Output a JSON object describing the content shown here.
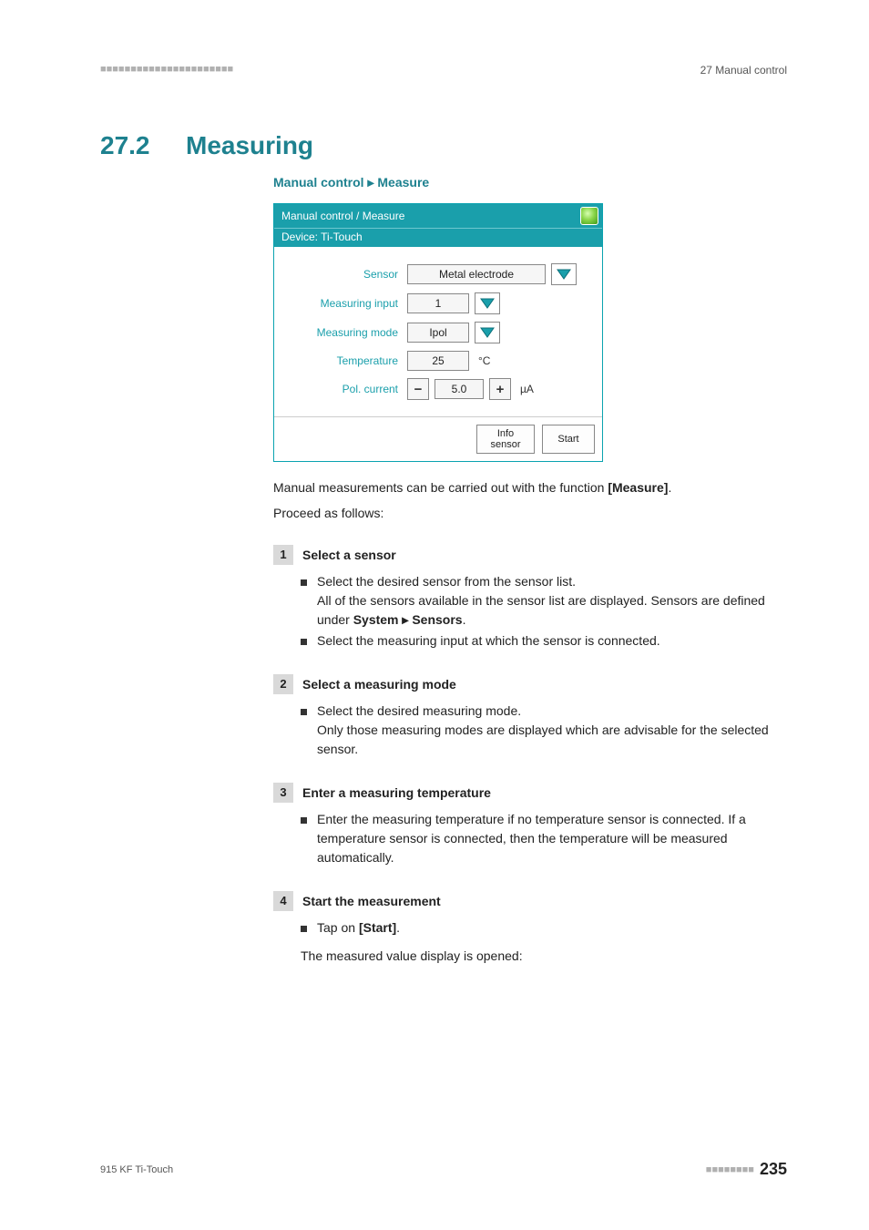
{
  "page": {
    "chapter_ref": "27 Manual control",
    "section_number": "27.2",
    "section_title": "Measuring",
    "breadcrumb_prefix": "Manual control",
    "breadcrumb_sep": "▸",
    "breadcrumb_leaf": "Measure",
    "paragraph_1a": "Manual measurements can be carried out with the function ",
    "paragraph_1_bold": "[Measure]",
    "paragraph_1b": ".",
    "paragraph_2": "Proceed as follows:",
    "footer_device": "915 KF Ti-Touch",
    "page_number": "235"
  },
  "panel": {
    "title": "Manual control / Measure",
    "device_line": "Device: Ti-Touch",
    "rows": {
      "sensor": {
        "label": "Sensor",
        "value": "Metal electrode"
      },
      "measuring_input": {
        "label": "Measuring input",
        "value": "1"
      },
      "measuring_mode": {
        "label": "Measuring mode",
        "value": "Ipol"
      },
      "temperature": {
        "label": "Temperature",
        "value": "25",
        "unit": "°C"
      },
      "pol_current": {
        "label": "Pol. current",
        "value": "5.0",
        "unit": "µA",
        "minus": "−",
        "plus": "+"
      }
    },
    "buttons": {
      "info_sensor": "Info\nsensor",
      "start": "Start"
    }
  },
  "steps": [
    {
      "num": "1",
      "title": "Select a sensor",
      "bullets": [
        {
          "text": "Select the desired sensor from the sensor list.\nAll of the sensors available in the sensor list are displayed. Sensors are defined under ",
          "bold": "System ▸ Sensors",
          "tail": "."
        },
        {
          "text": "Select the measuring input at which the sensor is connected."
        }
      ]
    },
    {
      "num": "2",
      "title": "Select a measuring mode",
      "bullets": [
        {
          "text": "Select the desired measuring mode.\nOnly those measuring modes are displayed which are advisable for the selected sensor."
        }
      ]
    },
    {
      "num": "3",
      "title": "Enter a measuring temperature",
      "bullets": [
        {
          "text": "Enter the measuring temperature if no temperature sensor is connected. If a temperature sensor is connected, then the temperature will be measured automatically."
        }
      ]
    },
    {
      "num": "4",
      "title": "Start the measurement",
      "bullets": [
        {
          "text": "Tap on ",
          "bold": "[Start]",
          "tail": "."
        }
      ],
      "after": "The measured value display is opened:"
    }
  ]
}
